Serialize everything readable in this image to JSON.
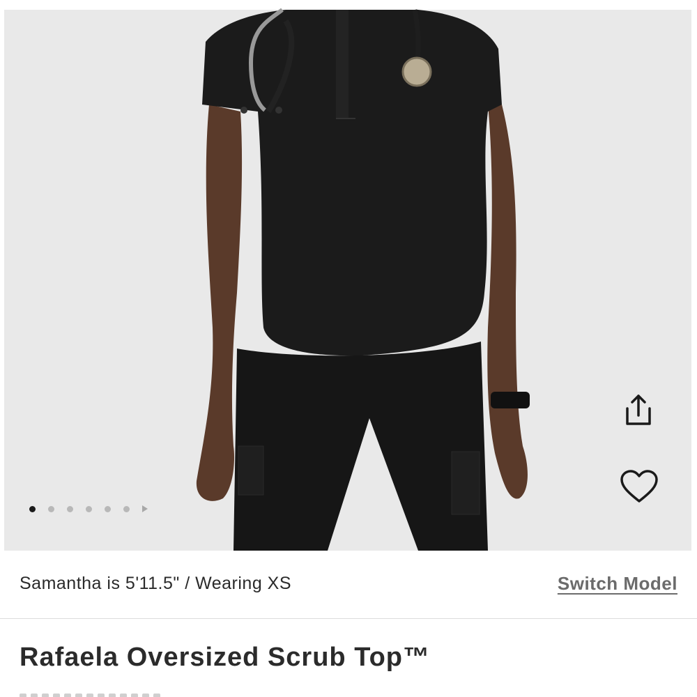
{
  "hero": {
    "carousel": {
      "total": 6,
      "active": 0
    },
    "share_icon": "share-icon",
    "favorite_icon": "heart-icon"
  },
  "model_info": {
    "text": "Samantha is 5'11.5\" / Wearing XS",
    "switch_label": "Switch Model"
  },
  "product": {
    "title": "Rafaela Oversized Scrub Top™"
  },
  "colors": {
    "background": "#e9e9e9",
    "garment": "#1b1b1b",
    "skin": "#5a3a2a",
    "text": "#2b2b2b",
    "link": "#6b6b6b"
  }
}
